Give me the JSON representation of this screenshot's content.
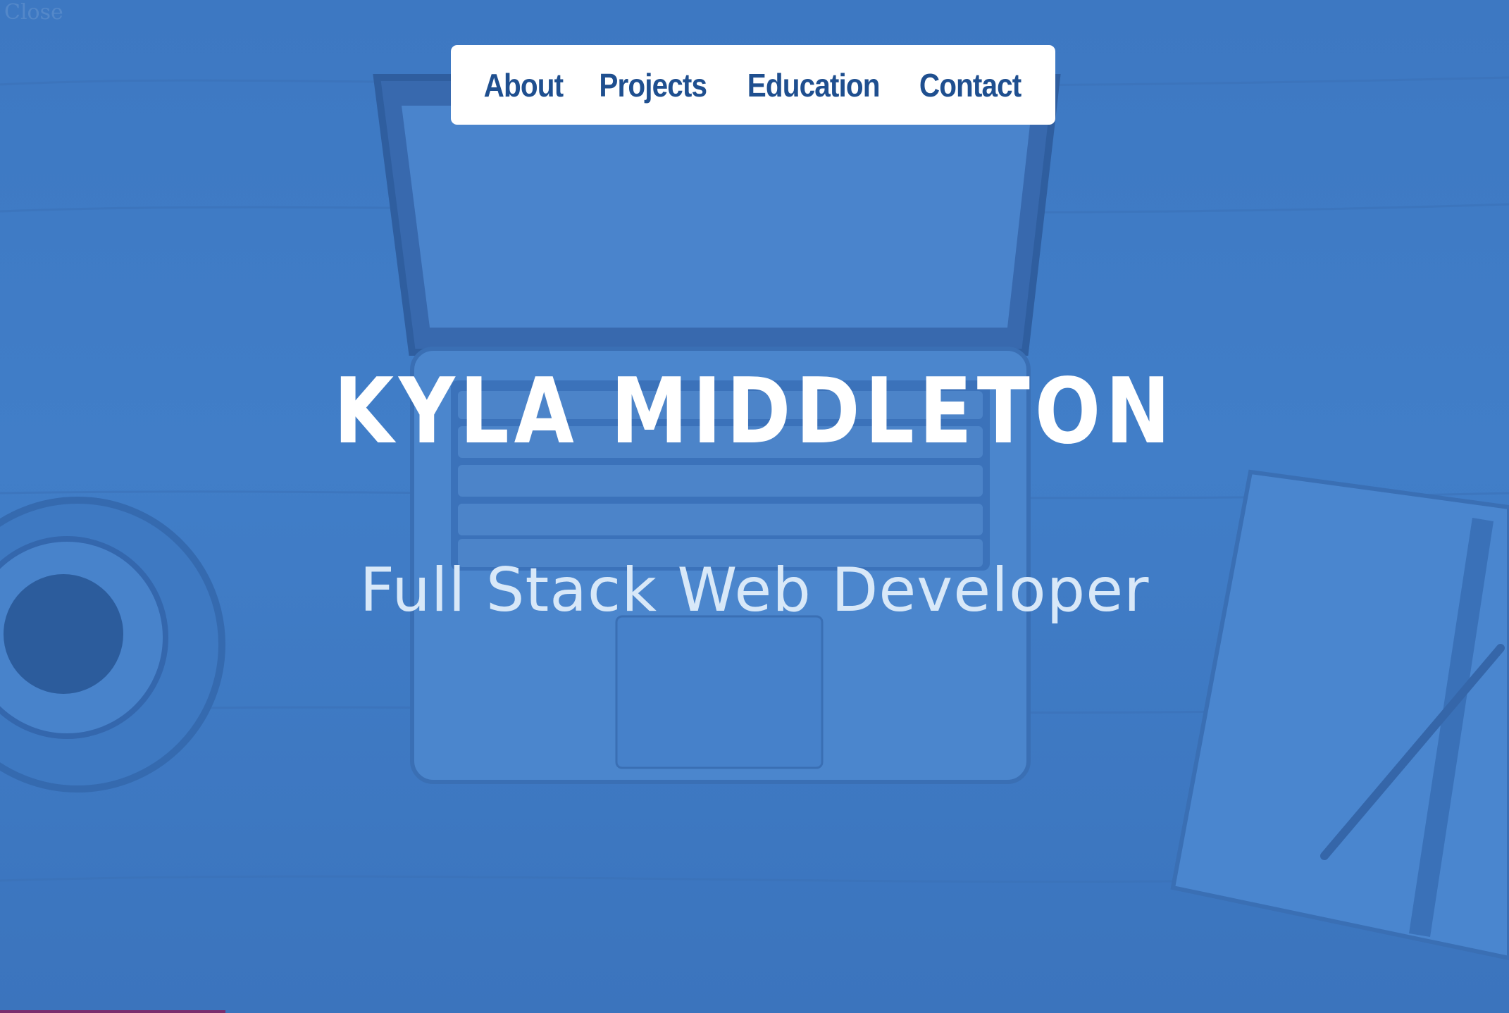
{
  "page": {
    "corner_text": "Close"
  },
  "nav": {
    "items": [
      {
        "label": "About"
      },
      {
        "label": "Projects"
      },
      {
        "label": "Education"
      },
      {
        "label": "Contact"
      }
    ]
  },
  "hero": {
    "name": "KYLA MIDDLETON",
    "subtitle": "Full Stack Web Developer"
  },
  "colors": {
    "overlay": "#3f7bc5",
    "nav_bg": "#ffffff",
    "nav_text": "#1f4f8f",
    "name_text": "#ffffff",
    "subtitle_text": "#d8e8f8"
  }
}
